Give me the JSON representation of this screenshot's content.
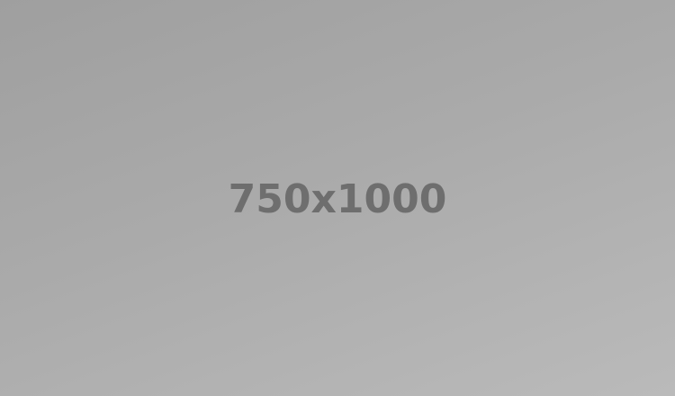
{
  "placeholder": {
    "label": "750x1000",
    "background_colors": [
      "#9f9f9f",
      "#bababa"
    ],
    "text_color": "#6e6e6e"
  }
}
